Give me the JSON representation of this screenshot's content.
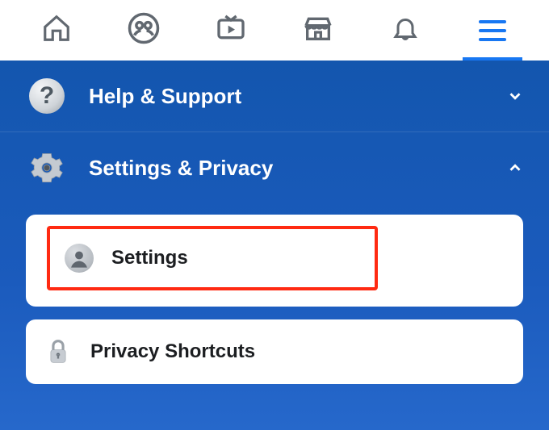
{
  "nav": {
    "items": [
      {
        "name": "home"
      },
      {
        "name": "groups"
      },
      {
        "name": "watch"
      },
      {
        "name": "marketplace"
      },
      {
        "name": "notifications"
      },
      {
        "name": "menu",
        "active": true
      }
    ]
  },
  "menu": {
    "help": {
      "label": "Help & Support",
      "expanded": false
    },
    "settings_privacy": {
      "label": "Settings & Privacy",
      "expanded": true,
      "items": {
        "settings": {
          "label": "Settings",
          "highlighted": true
        },
        "privacy_shortcuts": {
          "label": "Privacy Shortcuts"
        }
      }
    }
  },
  "colors": {
    "accent": "#1877f2",
    "panel": "#134fa6",
    "highlight_border": "#ff2a12"
  }
}
